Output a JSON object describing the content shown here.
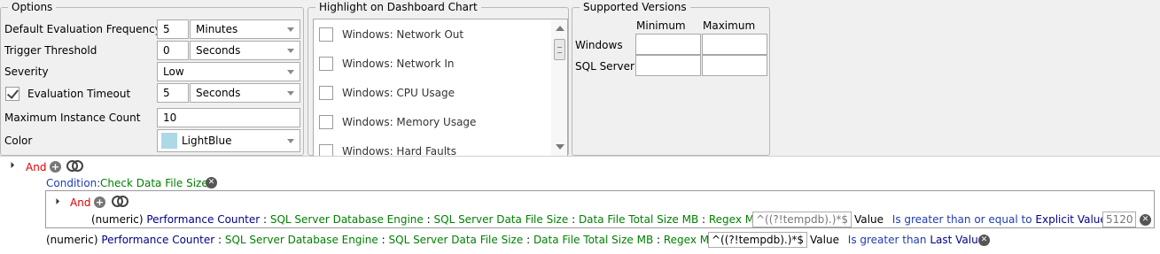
{
  "options": {
    "title": "Options",
    "default_eval_freq": {
      "label": "Default Evaluation Frequency",
      "value": "5",
      "unit": "Minutes"
    },
    "trigger_threshold": {
      "label": "Trigger Threshold",
      "value": "0",
      "unit": "Seconds"
    },
    "severity": {
      "label": "Severity",
      "value": "Low"
    },
    "evaluation_timeout": {
      "label": "Evaluation Timeout",
      "checked": true,
      "value": "5",
      "unit": "Seconds"
    },
    "max_instance_count": {
      "label": "Maximum Instance Count",
      "value": "10"
    },
    "color": {
      "label": "Color",
      "value": "LightBlue",
      "swatch": "#add8e6"
    }
  },
  "highlight": {
    "title": "Highlight on Dashboard Chart",
    "items": [
      {
        "label": "Windows: Network Out",
        "checked": false
      },
      {
        "label": "Windows: Network In",
        "checked": false
      },
      {
        "label": "Windows: CPU Usage",
        "checked": false
      },
      {
        "label": "Windows: Memory Usage",
        "checked": false
      },
      {
        "label": "Windows: Hard Faults",
        "checked": false
      }
    ]
  },
  "supported_versions": {
    "title": "Supported Versions",
    "col_min": "Minimum",
    "col_max": "Maximum",
    "rows": [
      {
        "label": "Windows",
        "min": "",
        "max": ""
      },
      {
        "label": "SQL Server",
        "min": "",
        "max": ""
      }
    ]
  },
  "tree": {
    "root_op": "And",
    "condition_label": "Condition:",
    "condition_name": "Check Data File Size",
    "nested_op": "And",
    "rule1": {
      "type": "(numeric)",
      "source": "Performance Counter",
      "sep1": ":",
      "engine": "SQL Server Database Engine",
      "sep2": ":",
      "object": "SQL Server Data File Size",
      "sep3": ":",
      "counter": "Data File Total Size MB",
      "sep4": ":",
      "match": "Regex Match",
      "sep5": ":",
      "regex": "^((?!tempdb).)*$",
      "value_word": "Value",
      "comparison": "Is greater than or equal to",
      "target": "Explicit Value",
      "sep6": ":",
      "target_value": "5120"
    },
    "rule2": {
      "type": "(numeric)",
      "source": "Performance Counter",
      "sep1": ":",
      "engine": "SQL Server Database Engine",
      "sep2": ":",
      "object": "SQL Server Data File Size",
      "sep3": ":",
      "counter": "Data File Total Size MB",
      "sep4": ":",
      "match": "Regex Match",
      "sep5": ":",
      "regex": "^((?!tempdb).)*$",
      "value_word": "Value",
      "comparison": "Is greater than",
      "target": "Last Value"
    }
  },
  "icons": {
    "add": "add-circle-icon",
    "group": "group-rings-icon",
    "remove": "remove-circle-icon",
    "expander": "expander-triangle-icon"
  }
}
